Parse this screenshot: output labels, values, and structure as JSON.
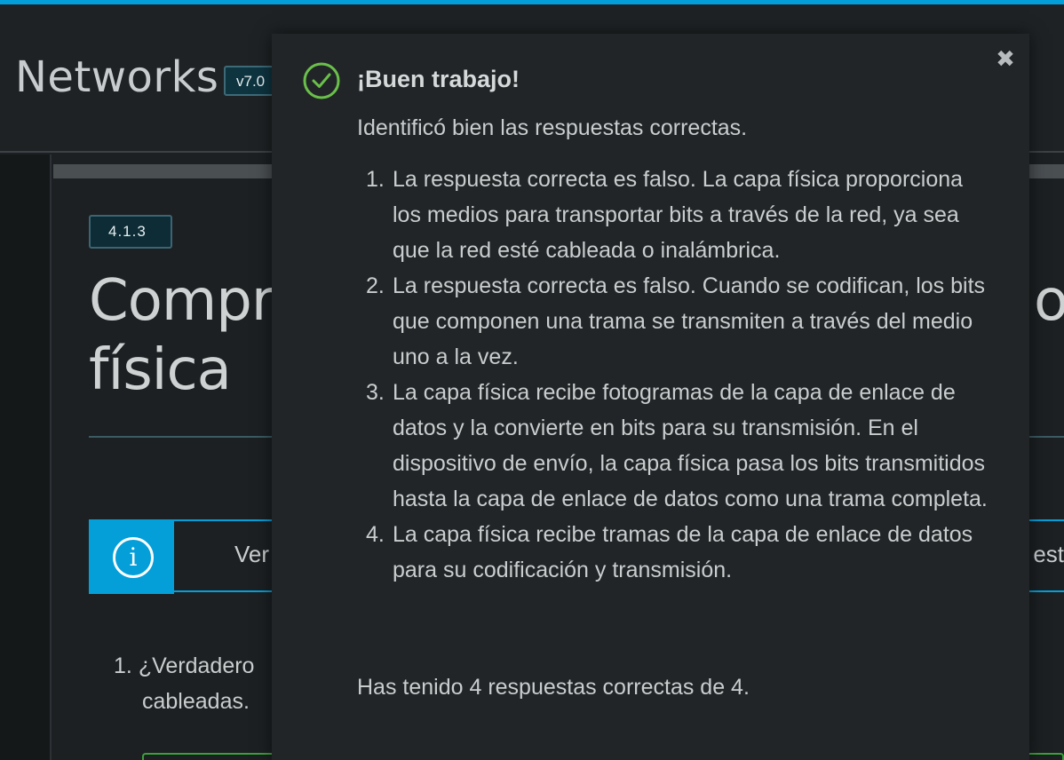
{
  "header": {
    "app_title": "Networks",
    "version": "v7.0"
  },
  "section": {
    "number": "4.1.3",
    "title_line1": "Compr",
    "title_line1_right": "os",
    "title_line2": "física"
  },
  "info_bar": {
    "left_text": "Ver",
    "right_text": "est"
  },
  "question_preview": {
    "number": "1.",
    "line1": "¿Verdadero",
    "line2": "cableadas."
  },
  "modal": {
    "close_label": "✖",
    "title": "¡Buen trabajo!",
    "intro": "Identificó bien las respuestas correctas.",
    "answers": [
      {
        "num": "1.",
        "text": "La respuesta correcta es falso. La capa física proporciona los medios para transportar bits a través de la red, ya sea que la red esté cableada o inalámbrica."
      },
      {
        "num": "2.",
        "text": "La respuesta correcta es falso. Cuando se codifican, los bits que componen una trama se transmiten a través del medio uno a la vez."
      },
      {
        "num": "3.",
        "text": "La capa física recibe fotogramas de la capa de enlace de datos y la convierte en bits para su transmisión. En el dispositivo de envío, la capa física pasa los bits transmitidos hasta la capa de enlace de datos como una trama completa."
      },
      {
        "num": "4.",
        "text": "La capa física recibe tramas de la capa de enlace de datos para su codificación y transmisión."
      }
    ],
    "score": "Has tenido 4 respuestas correctas de 4.",
    "success_color": "#6abf4b"
  },
  "colors": {
    "accent": "#049fd9",
    "background": "#1c2022"
  }
}
